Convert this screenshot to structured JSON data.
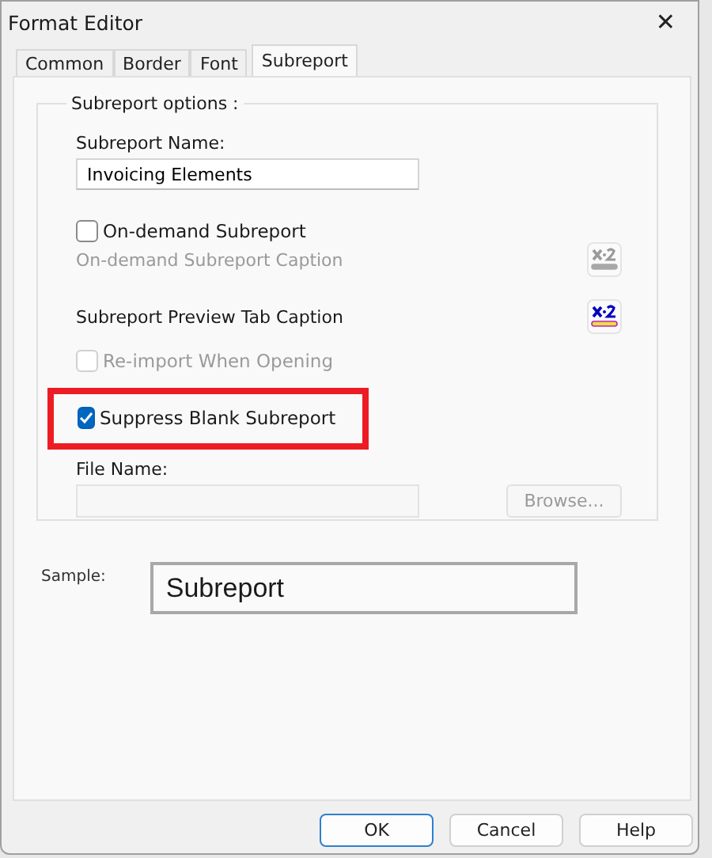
{
  "window": {
    "title": "Format Editor",
    "close": "✕"
  },
  "tabs": [
    {
      "label": "Common",
      "selected": false
    },
    {
      "label": "Border",
      "selected": false
    },
    {
      "label": "Font",
      "selected": false
    },
    {
      "label": "Subreport",
      "selected": true
    }
  ],
  "group": {
    "title": "Subreport options :",
    "name_label": "Subreport Name:",
    "name_value": "Invoicing Elements",
    "items": [
      {
        "kind": "checkbox",
        "label": "On-demand Subreport",
        "checked": false,
        "disabled": false,
        "highlighted": false
      },
      {
        "kind": "caption",
        "label": "On-demand Subreport Caption",
        "disabled": true
      },
      {
        "kind": "caption",
        "label": "Subreport Preview Tab Caption",
        "disabled": false
      },
      {
        "kind": "checkbox",
        "label": "Re-import When Opening",
        "checked": false,
        "disabled": true,
        "highlighted": false
      },
      {
        "kind": "checkbox",
        "label": "Suppress Blank Subreport",
        "checked": true,
        "disabled": false,
        "highlighted": true
      }
    ],
    "file_label": "File Name:",
    "browse": {
      "label": "Browse...",
      "disabled": true
    }
  },
  "sample": {
    "label": "Sample:",
    "text": "Subreport"
  },
  "buttons": [
    {
      "label": "OK",
      "default": true
    },
    {
      "label": "Cancel",
      "default": false
    },
    {
      "label": "Help",
      "default": false
    }
  ]
}
